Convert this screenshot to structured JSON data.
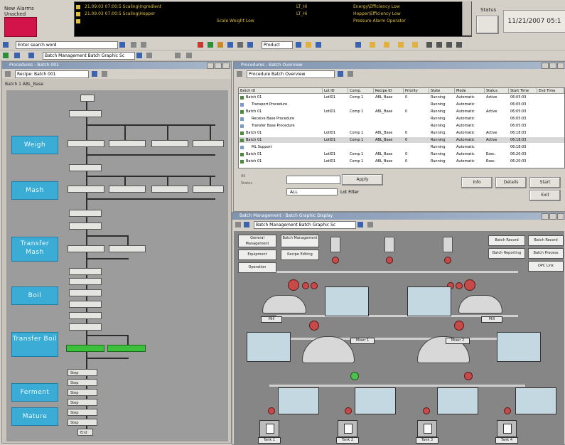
{
  "header": {
    "alarm_label": "New Alarms Unacked",
    "alarm_button": "!!",
    "system_label": "Status",
    "system_button": "+",
    "datetime": "11/21/2007 05:1"
  },
  "alarms": [
    {
      "time": "21.09.03 07:00:5 Scaling\\Ingredient",
      "val": "LT_Hi",
      "msg": "Energy\\Efficiency Low"
    },
    {
      "time": "21.09.03 07:00:5 Scaling\\Hopper",
      "val": "LT_Hi",
      "msg": "Hopper\\Efficiency Low"
    },
    {
      "time": "",
      "val": "Scale Weight Low",
      "msg": "Pressure Alarm Operator"
    }
  ],
  "toolbar1": {
    "search_value": "Enter search word"
  },
  "toolbar2": {
    "view_value": "Batch Management Batch Graphic Sc",
    "bottom_value": "Product"
  },
  "left_window": {
    "title": "Procedures - Batch 001",
    "dropdown": "Recipe: Batch 001",
    "breadcrumb": "Batch 1  ABL_Base",
    "stages": [
      "Weigh",
      "Mash",
      "Transfer Mash",
      "Boil",
      "Transfer Boil",
      "Ferment",
      "Mature"
    ],
    "steps_final": [
      "Step",
      "Step",
      "Step",
      "Step",
      "Step",
      "Step",
      "End"
    ]
  },
  "right_top_window": {
    "title": "Procedures - Batch Overview",
    "dropdown": "Procedure Batch Overview",
    "columns": [
      "Batch ID",
      "Lot ID",
      "Comp.",
      "Recipe ID",
      "Priority",
      "State",
      "Mode",
      "Status",
      "Start Time",
      "End Time"
    ],
    "rows": [
      [
        "Batch 01",
        "LotID1",
        "Comp 1",
        "ABL_Base",
        "0",
        "Running",
        "Automatic",
        "Active",
        "06:05:03",
        ""
      ],
      [
        "Transport Procedure",
        "",
        "",
        "",
        "",
        "Running",
        "Automatic",
        "",
        "06:05:03",
        ""
      ],
      [
        "Batch 01",
        "LotID1",
        "Comp 1",
        "ABL_Base",
        "0",
        "Running",
        "Automatic",
        "Active",
        "06:05:03",
        ""
      ],
      [
        "Receive Base Procedure",
        "",
        "",
        "",
        "",
        "Running",
        "Automatic",
        "",
        "06:05:03",
        ""
      ],
      [
        "Transfer Base Procedure",
        "",
        "",
        "",
        "",
        "Running",
        "Automatic",
        "",
        "06:05:03",
        ""
      ],
      [
        "Batch 01",
        "LotID1",
        "Comp 1",
        "ABL_Base",
        "0",
        "Running",
        "Automatic",
        "Active",
        "06:18:03",
        ""
      ],
      [
        "Batch 01",
        "LotID1",
        "Comp 1",
        "ABL_Base",
        "0",
        "Running",
        "Automatic",
        "Active",
        "06:18:03",
        ""
      ],
      [
        "ML Support",
        "",
        "",
        "",
        "",
        "Running",
        "Automatic",
        "",
        "06:18:03",
        ""
      ],
      [
        "Batch 01",
        "LotID1",
        "Comp 1",
        "ABL_Base",
        "0",
        "Running",
        "Automatic",
        "Exec.",
        "06:20:03",
        ""
      ],
      [
        "Batch 01",
        "LotID1",
        "Comp 1",
        "ABL_Base",
        "0",
        "Running",
        "Automatic",
        "Exec.",
        "06:20:03",
        ""
      ]
    ],
    "filter_label1": "All",
    "filter_label2": "Status",
    "select_value": "ALL",
    "check_label": "Lot Filter",
    "btn_apply": "Apply",
    "btn_info": "Info",
    "btn_details": "Details",
    "btn_start": "Start",
    "btn_exit": "Exit"
  },
  "right_bottom_window": {
    "title": "Batch Management - Batch Graphic Display",
    "dropdown": "Batch Management Batch Graphic Sc",
    "left_buttons": [
      "General Management",
      "Batch Management",
      "Equipment",
      "Recipe Editing",
      "Operation"
    ],
    "right_buttons": [
      "Batch Record",
      "Batch Record",
      "Batch Reporting",
      "Batch Process",
      "OPC Link"
    ],
    "tags": [
      "Mill",
      "Mill",
      "Mixer 1",
      "Mixer 2",
      "Tank 1",
      "Tank 2",
      "Tank 3",
      "Tank 4"
    ]
  }
}
